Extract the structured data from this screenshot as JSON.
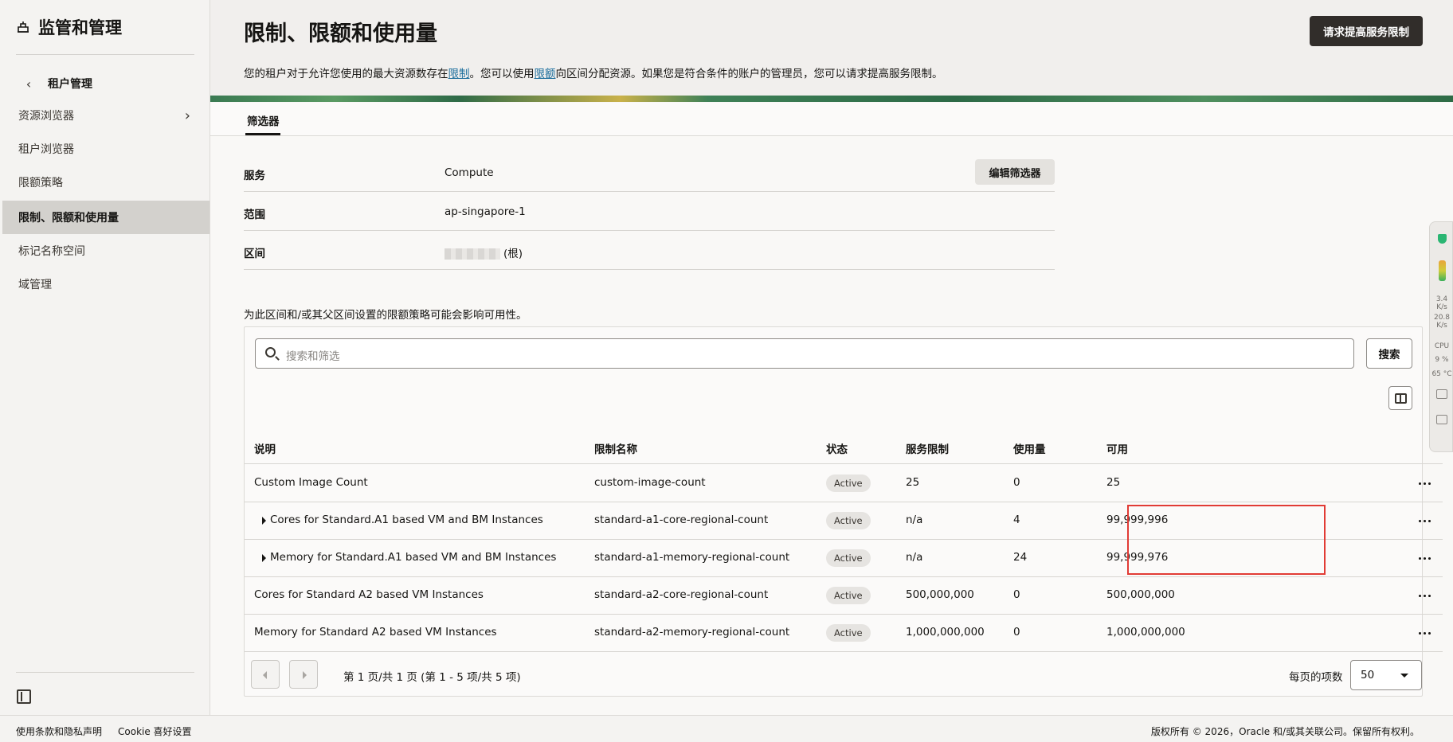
{
  "sidebar": {
    "title": "监管和管理",
    "back_label": "租户管理",
    "items": [
      {
        "label": "资源浏览器",
        "has_arrow": true
      },
      {
        "label": "租户浏览器"
      },
      {
        "label": "限额策略"
      },
      {
        "label": "限制、限额和使用量",
        "active": true
      },
      {
        "label": "标记名称空间"
      },
      {
        "label": "域管理"
      }
    ]
  },
  "header": {
    "title": "限制、限额和使用量",
    "desc_1": "您的租户对于允许您使用的最大资源数存在",
    "desc_link_1": "限制",
    "desc_2": "。您可以使用",
    "desc_link_2": "限额",
    "desc_3": "向区间分配资源。如果您是符合条件的账户的管理员，您可以请求提高服务限制。",
    "request_button": "请求提高服务限制"
  },
  "tabs": [
    {
      "label": "筛选器",
      "active": true
    }
  ],
  "filters": {
    "service_label": "服务",
    "service_value": "Compute",
    "scope_label": "范围",
    "scope_value": "ap-singapore-1",
    "compartment_label": "区间",
    "compartment_value": "(根)",
    "edit_button": "编辑筛选器"
  },
  "note": "为此区间和/或其父区间设置的限额策略可能会影响可用性。",
  "search": {
    "placeholder": "搜索和筛选",
    "button": "搜索"
  },
  "table": {
    "headers": [
      "说明",
      "限制名称",
      "状态",
      "服务限制",
      "使用量",
      "可用"
    ],
    "rows": [
      {
        "desc": "Custom Image Count",
        "name": "custom-image-count",
        "status": "Active",
        "limit": "25",
        "usage": "0",
        "available": "25",
        "expandable": false
      },
      {
        "desc": "Cores for Standard.A1 based VM and BM Instances",
        "name": "standard-a1-core-regional-count",
        "status": "Active",
        "limit": "n/a",
        "usage": "4",
        "available": "99,999,996",
        "expandable": true
      },
      {
        "desc": "Memory for Standard.A1 based VM and BM Instances",
        "name": "standard-a1-memory-regional-count",
        "status": "Active",
        "limit": "n/a",
        "usage": "24",
        "available": "99,999,976",
        "expandable": true
      },
      {
        "desc": "Cores for Standard A2 based VM Instances",
        "name": "standard-a2-core-regional-count",
        "status": "Active",
        "limit": "500,000,000",
        "usage": "0",
        "available": "500,000,000",
        "expandable": false
      },
      {
        "desc": "Memory for Standard A2 based VM Instances",
        "name": "standard-a2-memory-regional-count",
        "status": "Active",
        "limit": "1,000,000,000",
        "usage": "0",
        "available": "1,000,000,000",
        "expandable": false
      }
    ]
  },
  "pagination": {
    "summary": "第 1 页/共 1 页 (第 1 - 5 项/共 5 项)",
    "per_page_label": "每页的项数",
    "per_page_value": "50"
  },
  "widget": {
    "up_rate": "3.4",
    "up_unit": "K/s",
    "down_rate": "20.8",
    "down_unit": "K/s",
    "cpu_label": "CPU",
    "cpu_value": "9 %",
    "temp": "65 °C"
  },
  "footer": {
    "terms": "使用条款和隐私声明",
    "cookie": "Cookie 喜好设置",
    "copyright": "版权所有 © 2026，Oracle 和/或其关联公司。保留所有权利。"
  },
  "colors": {
    "primary_button": "#312d2a",
    "highlight": "#e13b35",
    "link": "#1a6d9c"
  }
}
